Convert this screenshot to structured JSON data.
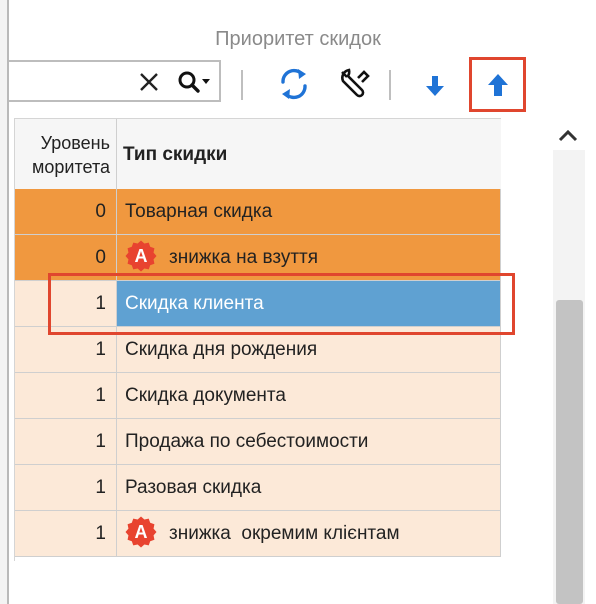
{
  "window": {
    "title": "Приоритет скидок"
  },
  "toolbar": {
    "search_value": "",
    "buttons": [
      {
        "icon": "refresh-icon"
      },
      {
        "icon": "wrench-icon"
      },
      {
        "icon": "arrow-down-icon"
      },
      {
        "icon": "arrow-up-icon",
        "highlighted": true
      }
    ]
  },
  "grid": {
    "columns": {
      "level": "Уровень\nмоитета",
      "type": "Тип скидки"
    },
    "level_header_lines": [
      "Уровень",
      "моритета"
    ],
    "rows": [
      {
        "level": "0",
        "type": "Товарная скидка",
        "style": "orange",
        "badge": false
      },
      {
        "level": "0",
        "type": "знижка на взуття",
        "style": "orange",
        "badge": true,
        "badge_letter": "A"
      },
      {
        "level": "1",
        "type": "Скидка клиента",
        "style": "selected",
        "badge": false
      },
      {
        "level": "1",
        "type": "Скидка дня рождения",
        "style": "peach",
        "badge": false
      },
      {
        "level": "1",
        "type": "Скидка документа",
        "style": "peach",
        "badge": false
      },
      {
        "level": "1",
        "type": "Продажа по себестоимости",
        "style": "peach",
        "badge": false
      },
      {
        "level": "1",
        "type": "Разовая скидка",
        "style": "peach",
        "badge": false
      },
      {
        "level": "1",
        "type": "знижка  окремим клієнтам",
        "style": "peach",
        "badge": true,
        "badge_letter": "A"
      }
    ]
  },
  "colors": {
    "orange_row": "#f0983f",
    "peach_row": "#fce9d8",
    "selected_cell": "#5fa1d2",
    "highlight": "#e0462e",
    "icon_blue": "#1f73d6",
    "badge_red": "#e8432f"
  }
}
